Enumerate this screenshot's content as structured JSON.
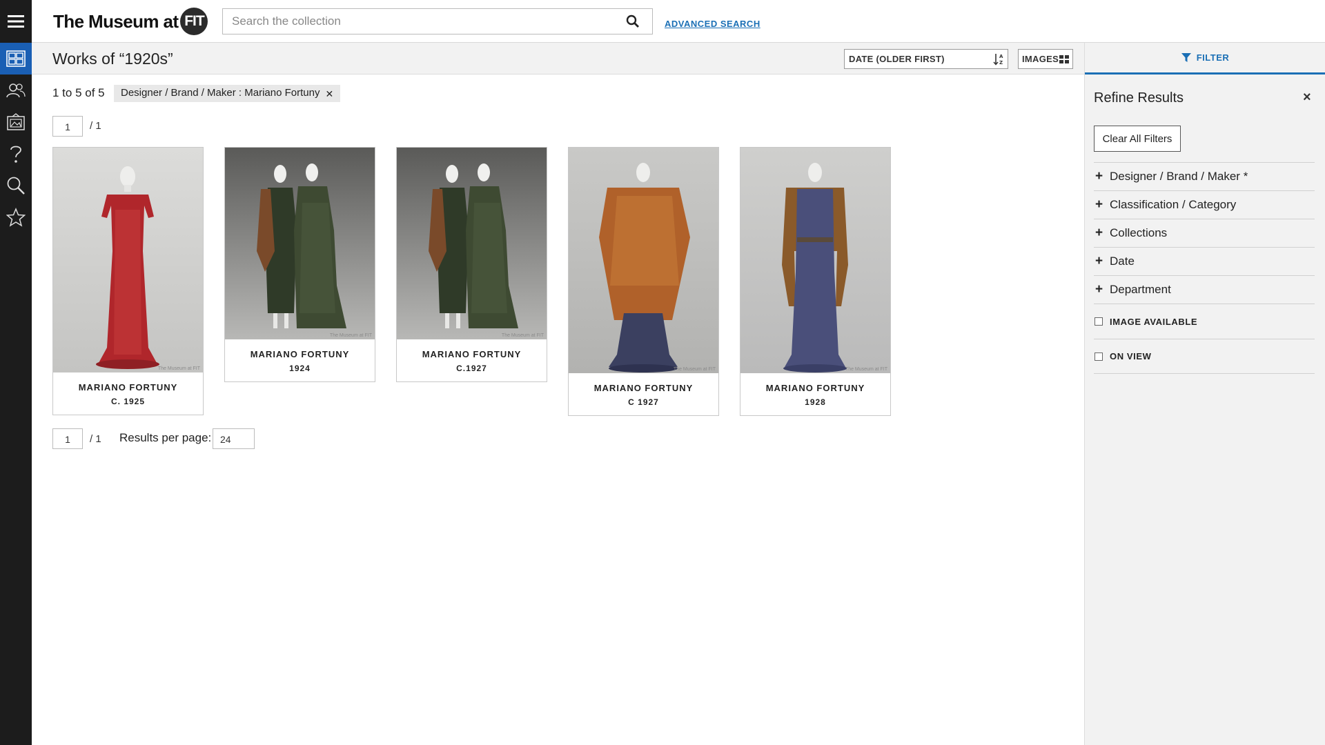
{
  "header": {
    "logo_text": "The Museum at",
    "logo_badge": "FIT",
    "search_placeholder": "Search the collection",
    "advanced_search": "ADVANCED SEARCH"
  },
  "rail": {
    "icons": [
      "hamburger-menu-icon",
      "collection-grid-icon",
      "people-icon",
      "gallery-icon",
      "help-icon",
      "zoom-search-icon",
      "star-icon"
    ],
    "active_color": "#1a5fb4"
  },
  "toolbar": {
    "title": "Works of “1920s”",
    "sort_label": "DATE (OLDER FIRST)",
    "view_label": "IMAGES"
  },
  "results": {
    "count_text": "1 to 5 of 5",
    "active_filter": "Designer / Brand / Maker : Mariano Fortuny",
    "page_current": "1",
    "page_total": "/ 1",
    "results_per_page_label": "Results per page:",
    "results_per_page_value": "24"
  },
  "items": [
    {
      "name": "MARIANO FORTUNY",
      "date": "C. 1925",
      "watermark": "The Museum at FIT"
    },
    {
      "name": "MARIANO FORTUNY",
      "date": "1924",
      "watermark": "The Museum at FIT"
    },
    {
      "name": "MARIANO FORTUNY",
      "date": "C.1927",
      "watermark": "The Museum at FIT"
    },
    {
      "name": "MARIANO FORTUNY",
      "date": "C 1927",
      "watermark": "The Museum at FIT"
    },
    {
      "name": "MARIANO FORTUNY",
      "date": "1928",
      "watermark": "The Museum at FIT"
    }
  ],
  "sidebar": {
    "tab_label": "FILTER",
    "title": "Refine Results",
    "close": "×",
    "clear_all": "Clear All Filters",
    "facets": [
      {
        "label": "Designer / Brand / Maker *"
      },
      {
        "label": "Classification / Category"
      },
      {
        "label": "Collections"
      },
      {
        "label": "Date"
      },
      {
        "label": "Department"
      }
    ],
    "checkboxes": [
      {
        "label": "IMAGE AVAILABLE"
      },
      {
        "label": "ON VIEW"
      }
    ],
    "accent_color": "#1a6fb5"
  }
}
